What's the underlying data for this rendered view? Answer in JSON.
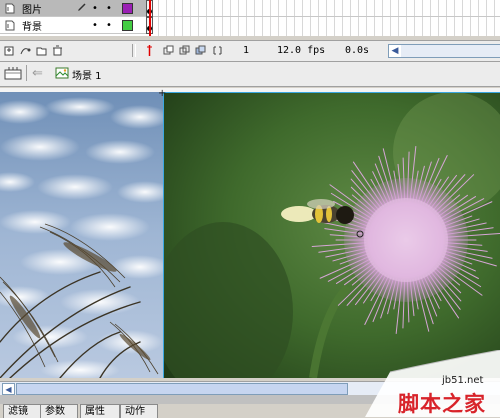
{
  "timeline": {
    "layers": [
      {
        "name": "图片",
        "selected": true,
        "color": "#9a20b4"
      },
      {
        "name": "背景",
        "selected": false,
        "color": "#44cc44"
      }
    ],
    "current_frame": "1",
    "fps": "12.0 fps",
    "elapsed": "0.0s"
  },
  "edit_bar": {
    "scene": "场景 1"
  },
  "tabs": [
    "滤镜",
    "参数",
    "属性",
    "动作"
  ],
  "watermark": {
    "url": "jb51.net",
    "text": "脚本之家"
  },
  "colors": {
    "selection_border": "#3aa7e0",
    "playhead": "#e00000",
    "watermark_red": "#d8232a"
  }
}
